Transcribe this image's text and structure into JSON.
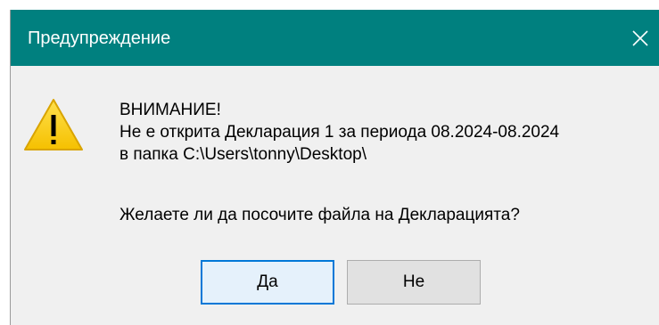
{
  "dialog": {
    "title": "Предупреждение",
    "close_glyph": "✕",
    "icon": "warning-icon",
    "message_lines": [
      "ВНИМАНИЕ!",
      "Не е открита Декларация 1 за периода 08.2024-08.2024",
      "в папка C:\\Users\\tonny\\Desktop\\"
    ],
    "question": "Желаете ли да посочите файла на Декларацията?",
    "buttons": {
      "yes_label": "Да",
      "no_label": "Не"
    }
  },
  "colors": {
    "titlebar": "#00807f",
    "body": "#f0f0f0",
    "default_button_border": "#0078d7",
    "warning_fill": "#ffcc00"
  }
}
